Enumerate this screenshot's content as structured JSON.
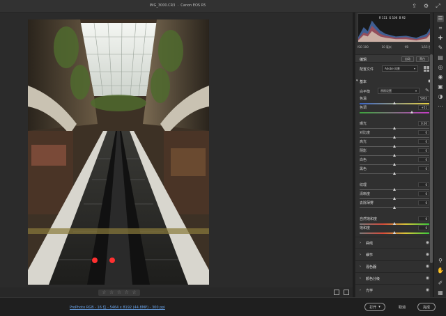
{
  "window": {
    "title": "IMG_3000.CR3  ·  Canon EOS R5"
  },
  "top_icons": [
    "export-icon",
    "gear-icon",
    "expand-icon"
  ],
  "histogram": {
    "readout": "R 111  G 106  B 92"
  },
  "exif": {
    "iso": "ISO 100",
    "focal": "10 毫米",
    "aperture": "f/8",
    "shutter": "1/15 秒"
  },
  "profile_section": {
    "title": "编辑",
    "auto_label": "自动",
    "bw_label": "黑白",
    "profile_label": "配置文件",
    "profile_value": "Adobe 风景"
  },
  "basic": {
    "title": "基本",
    "wb_label": "白平衡",
    "wb_value": "原照设置",
    "sliders": [
      {
        "label": "色温",
        "value": "5950",
        "pos": 0.5,
        "gradient": "temp"
      },
      {
        "label": "色调",
        "value": "+51",
        "pos": 0.75,
        "gradient": "tint"
      },
      {
        "label": "曝光",
        "value": "0.00",
        "pos": 0.5
      },
      {
        "label": "对比度",
        "value": "0",
        "pos": 0.5
      },
      {
        "label": "高光",
        "value": "0",
        "pos": 0.5
      },
      {
        "label": "阴影",
        "value": "0",
        "pos": 0.5
      },
      {
        "label": "白色",
        "value": "0",
        "pos": 0.5
      },
      {
        "label": "黑色",
        "value": "0",
        "pos": 0.5
      },
      {
        "label": "纹理",
        "value": "0",
        "pos": 0.5
      },
      {
        "label": "清晰度",
        "value": "0",
        "pos": 0.5
      },
      {
        "label": "去除薄雾",
        "value": "0",
        "pos": 0.5
      },
      {
        "label": "自然饱和度",
        "value": "0",
        "pos": 0.5,
        "gradient": "vib"
      },
      {
        "label": "饱和度",
        "value": "0",
        "pos": 0.5,
        "gradient": "sat"
      }
    ]
  },
  "panels": [
    {
      "label": "曲线"
    },
    {
      "label": "细节"
    },
    {
      "label": "混色器"
    },
    {
      "label": "颜色分级"
    },
    {
      "label": "光学"
    }
  ],
  "filmstrip": {
    "stars": [
      "☆",
      "☆",
      "☆",
      "☆",
      "☆"
    ]
  },
  "status": {
    "link": "ProPhoto RGB - 16 位 - 5464 x 8192 (44.8MP) - 300 ppi",
    "open_label": "打开",
    "cancel_label": "取消",
    "done_label": "完成"
  },
  "tools": [
    "sliders-icon",
    "crop-icon",
    "healing-icon",
    "brush-icon",
    "linear-gradient-icon",
    "radial-gradient-icon",
    "redeye-icon",
    "snapshot-icon",
    "preset-icon",
    "more-icon",
    "zoom-icon",
    "hand-icon",
    "sampler-icon",
    "grid-icon"
  ]
}
